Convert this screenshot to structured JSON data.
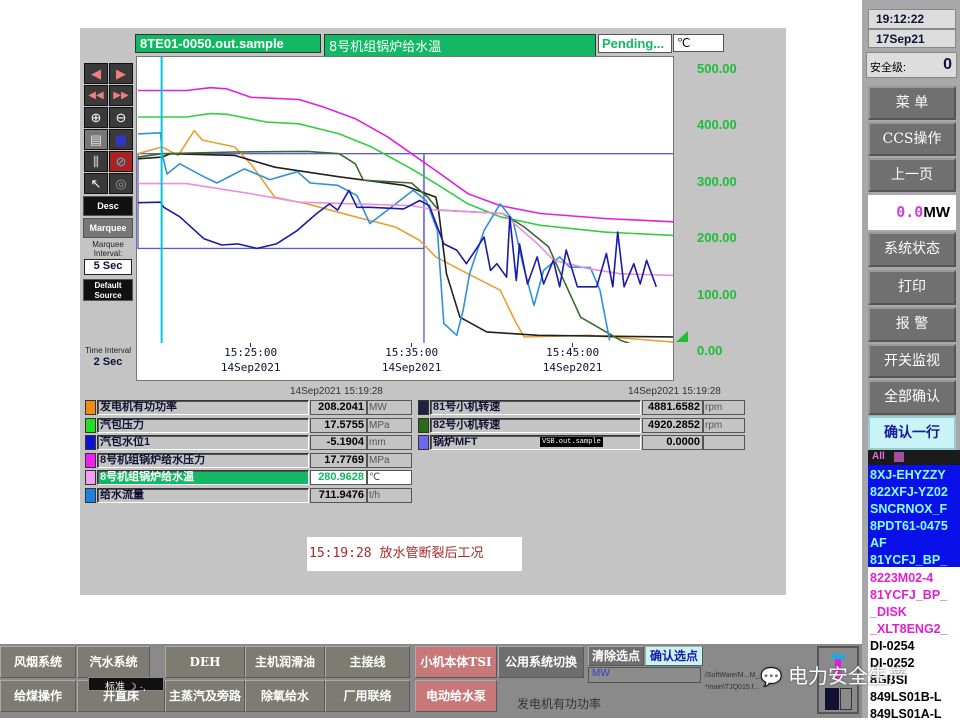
{
  "header": {
    "tag": "8TE01-0050.out.sample",
    "description": "8号机组锅炉给水温",
    "status": "Pending...",
    "unit": "℃"
  },
  "toolbar": {
    "icons": [
      "arrow-left-icon",
      "arrow-right-icon",
      "fast-rewind-icon",
      "fast-forward-icon",
      "zoom-in-icon",
      "zoom-out-icon",
      "window-icon",
      "table-icon",
      "trend-icon",
      "no-icon",
      "pointer-icon",
      "target-icon"
    ],
    "desc_label": "Desc",
    "marquee_label": "Marquee",
    "marquee_interval_label": "Marquee Interval:",
    "marquee_interval": "5 Sec",
    "default_source_label": "Default Source",
    "time_interval_label": "Time Interval :",
    "time_interval": "2 Sec"
  },
  "chart_data": {
    "type": "line",
    "ylim": [
      0,
      500
    ],
    "xlim": [
      "15:18:00",
      "15:51:18"
    ],
    "grid": false,
    "y_ticks": [
      "500.00",
      "400.00",
      "300.00",
      "200.00",
      "100.00",
      "0.00"
    ],
    "x_ticks": [
      {
        "time": "15:25:00",
        "date": "14Sep2021"
      },
      {
        "time": "15:35:00",
        "date": "14Sep2021"
      },
      {
        "time": "15:45:00",
        "date": "14Sep2021"
      }
    ],
    "cursor_time": "15:19:28",
    "cursor_color": "#00c8e0",
    "marquee": [
      {
        "from": "15:18:00",
        "to": "15:35:46",
        "low": 173,
        "high": 341
      },
      {
        "from": "15:35:46",
        "to": "15:51:18",
        "low": 0,
        "high": 341
      }
    ],
    "series": [
      {
        "name": "8号机组锅炉给水压力",
        "color": "#e020e0",
        "points": [
          [
            "15:18:00",
            453
          ],
          [
            "15:21:00",
            453
          ],
          [
            "15:22:30",
            458
          ],
          [
            "15:23:30",
            456
          ],
          [
            "15:25:00",
            441
          ],
          [
            "15:28:00",
            437
          ],
          [
            "15:29:30",
            424
          ],
          [
            "15:31:30",
            403
          ],
          [
            "15:33:30",
            371
          ],
          [
            "15:35:00",
            341
          ],
          [
            "15:36:30",
            311
          ],
          [
            "15:38:30",
            270
          ],
          [
            "15:40:30",
            249
          ],
          [
            "15:43:00",
            235
          ],
          [
            "15:47:00",
            226
          ],
          [
            "15:51:18",
            220
          ]
        ]
      },
      {
        "name": "汽包压力",
        "color": "#30d040",
        "points": [
          [
            "15:18:00",
            406
          ],
          [
            "15:21:00",
            406
          ],
          [
            "15:22:30",
            412
          ],
          [
            "15:23:30",
            411
          ],
          [
            "15:26:00",
            397
          ],
          [
            "15:28:00",
            394
          ],
          [
            "15:30:30",
            376
          ],
          [
            "15:32:30",
            353
          ],
          [
            "15:35:00",
            314
          ],
          [
            "15:36:30",
            288
          ],
          [
            "15:38:30",
            252
          ],
          [
            "15:40:30",
            229
          ],
          [
            "15:43:00",
            214
          ],
          [
            "15:47:00",
            202
          ],
          [
            "15:51:18",
            196
          ]
        ]
      },
      {
        "name": "发电机有功功率",
        "color": "#e8a030",
        "points": [
          [
            "15:18:00",
            341
          ],
          [
            "15:19:30",
            353
          ],
          [
            "15:20:30",
            338
          ],
          [
            "15:21:30",
            382
          ],
          [
            "15:22:00",
            365
          ],
          [
            "15:24:00",
            353
          ],
          [
            "15:25:00",
            323
          ],
          [
            "15:26:30",
            264
          ],
          [
            "15:28:30",
            252
          ],
          [
            "15:31:30",
            229
          ],
          [
            "15:34:00",
            211
          ],
          [
            "15:35:30",
            187
          ],
          [
            "15:36:30",
            158
          ],
          [
            "15:38:30",
            128
          ],
          [
            "15:40:30",
            99
          ],
          [
            "15:41:30",
            40
          ],
          [
            "15:42:00",
            16
          ],
          [
            "15:46:00",
            19
          ],
          [
            "15:51:18",
            7
          ]
        ]
      },
      {
        "name": "81号小机转速",
        "color": "#202020",
        "points": [
          [
            "15:18:00",
            332
          ],
          [
            "15:19:30",
            335
          ],
          [
            "15:20:00",
            341
          ],
          [
            "15:24:00",
            338
          ],
          [
            "15:26:30",
            317
          ],
          [
            "15:30:30",
            300
          ],
          [
            "15:34:30",
            285
          ],
          [
            "15:36:30",
            264
          ],
          [
            "15:36:40",
            241
          ],
          [
            "15:37:10",
            128
          ],
          [
            "15:38:00",
            51
          ],
          [
            "15:39:40",
            25
          ],
          [
            "15:42:50",
            19
          ],
          [
            "15:51:18",
            16
          ]
        ]
      },
      {
        "name": "82号小机转速",
        "color": "#3a6a2a",
        "points": [
          [
            "15:18:00",
            335
          ],
          [
            "15:19:30",
            341
          ],
          [
            "15:24:00",
            344
          ],
          [
            "15:28:30",
            345
          ],
          [
            "15:30:30",
            341
          ],
          [
            "15:31:30",
            323
          ],
          [
            "15:32:00",
            294
          ],
          [
            "15:35:00",
            289
          ],
          [
            "15:36:00",
            264
          ],
          [
            "15:36:40",
            241
          ],
          [
            "15:40:40",
            235
          ],
          [
            "15:42:00",
            211
          ],
          [
            "15:43:30",
            176
          ],
          [
            "15:44:10",
            134
          ],
          [
            "15:45:30",
            51
          ],
          [
            "15:48:00",
            10
          ],
          [
            "15:49:00",
            0
          ]
        ]
      },
      {
        "name": "给水流量",
        "color": "#3090d8",
        "points": [
          [
            "15:18:00",
            376
          ],
          [
            "15:19:24",
            378
          ],
          [
            "15:19:30",
            341
          ],
          [
            "15:19:48",
            305
          ],
          [
            "15:20:36",
            323
          ],
          [
            "15:22:06",
            300
          ],
          [
            "15:22:54",
            289
          ],
          [
            "15:24:36",
            314
          ],
          [
            "15:26:12",
            295
          ],
          [
            "15:27:54",
            309
          ],
          [
            "15:28:42",
            289
          ],
          [
            "15:30:24",
            285
          ],
          [
            "15:31:36",
            267
          ],
          [
            "15:32:24",
            217
          ],
          [
            "15:33:30",
            241
          ],
          [
            "15:35:06",
            276
          ],
          [
            "15:35:54",
            258
          ],
          [
            "15:36:36",
            205
          ],
          [
            "15:37:00",
            40
          ],
          [
            "15:37:48",
            19
          ],
          [
            "15:38:12",
            63
          ],
          [
            "15:38:36",
            128
          ],
          [
            "15:39:30",
            205
          ],
          [
            "15:40:30",
            252
          ],
          [
            "15:41:18",
            223
          ],
          [
            "15:41:54",
            146
          ],
          [
            "15:42:36",
            72
          ],
          [
            "15:43:12",
            134
          ],
          [
            "15:44:12",
            158
          ],
          [
            "15:44:48",
            140
          ],
          [
            "15:46:06",
            139
          ],
          [
            "15:46:42",
            99
          ],
          [
            "15:47:18",
            10
          ]
        ]
      },
      {
        "name": "8号机组锅炉给水温",
        "color": "#e890e0",
        "points": [
          [
            "15:18:00",
            288
          ],
          [
            "15:21:00",
            288
          ],
          [
            "15:25:00",
            270
          ],
          [
            "15:28:00",
            255
          ],
          [
            "15:35:00",
            249
          ],
          [
            "15:36:30",
            241
          ],
          [
            "15:40:40",
            235
          ],
          [
            "15:42:50",
            181
          ],
          [
            "15:43:50",
            152
          ],
          [
            "15:46:00",
            137
          ],
          [
            "15:48:00",
            128
          ],
          [
            "15:51:18",
            125
          ]
        ]
      },
      {
        "name": "汽包水位1",
        "color": "#1a1aa8",
        "points": [
          [
            "15:18:00",
            254
          ],
          [
            "15:19:24",
            255
          ],
          [
            "15:19:36",
            246
          ],
          [
            "15:20:36",
            229
          ],
          [
            "15:22:06",
            190
          ],
          [
            "15:23:12",
            179
          ],
          [
            "15:24:12",
            181
          ],
          [
            "15:25:24",
            173
          ],
          [
            "15:26:36",
            181
          ],
          [
            "15:27:54",
            205
          ],
          [
            "15:29:06",
            235
          ],
          [
            "15:29:54",
            252
          ],
          [
            "15:30:24",
            241
          ],
          [
            "15:31:06",
            276
          ],
          [
            "15:31:36",
            246
          ],
          [
            "15:32:24",
            246
          ],
          [
            "15:34:30",
            243
          ],
          [
            "15:35:30",
            258
          ],
          [
            "15:36:06",
            249
          ],
          [
            "15:37:00",
            181
          ],
          [
            "15:37:48",
            170
          ],
          [
            "15:38:24",
            146
          ],
          [
            "15:39:30",
            193
          ],
          [
            "15:39:54",
            134
          ],
          [
            "15:40:18",
            146
          ],
          [
            "15:40:54",
            122
          ],
          [
            "15:41:06",
            229
          ],
          [
            "15:41:30",
            116
          ],
          [
            "15:41:42",
            181
          ],
          [
            "15:42:12",
            110
          ],
          [
            "15:42:48",
            158
          ],
          [
            "15:43:12",
            110
          ],
          [
            "15:43:48",
            152
          ],
          [
            "15:44:12",
            105
          ],
          [
            "15:44:36",
            170
          ],
          [
            "15:45:18",
            105
          ],
          [
            "15:46:30",
            105
          ],
          [
            "15:47:06",
            164
          ],
          [
            "15:47:30",
            105
          ],
          [
            "15:47:48",
            202
          ],
          [
            "15:48:12",
            105
          ],
          [
            "15:48:48",
            146
          ],
          [
            "15:49:12",
            110
          ],
          [
            "15:49:36",
            152
          ],
          [
            "15:50:12",
            105
          ]
        ]
      }
    ]
  },
  "table": {
    "timestamp_left": "14Sep2021  15:19:28",
    "timestamp_right": "14Sep2021  15:19:28",
    "left_rows": [
      {
        "color": "#f08c14",
        "label": "发电机有功功率",
        "value": "208.2041",
        "unit": "MW"
      },
      {
        "color": "#20e020",
        "label": "汽包压力",
        "value": "17.5755",
        "unit": "MPa"
      },
      {
        "color": "#1010d0",
        "label": "汽包水位1",
        "value": "-5.1904",
        "unit": "mm"
      },
      {
        "color": "#f020f0",
        "label": "8号机组锅炉给水压力",
        "value": "17.7769",
        "unit": "MPa"
      },
      {
        "color": "#f0a0f0",
        "label": "8号机组锅炉给水温",
        "value": "280.9628",
        "unit": "℃",
        "selected": true
      },
      {
        "color": "#2080e0",
        "label": "给水流量",
        "value": "711.9476",
        "unit": "t/h"
      }
    ],
    "right_rows": [
      {
        "color": "#202040",
        "label": "81号小机转速",
        "value": "4881.6582",
        "unit": "rpm"
      },
      {
        "color": "#2a6a1a",
        "label": "82号小机转速",
        "value": "4920.2852",
        "unit": "rpm"
      },
      {
        "color": "#6a6af0",
        "label": "锅炉MFT",
        "tag": "VSB.out.sample",
        "value": "0.0000",
        "unit": ""
      }
    ]
  },
  "annotation": "15:19:28 放水管断裂后工况",
  "right_panel": {
    "time": "19:12:22",
    "date": "17Sep21",
    "security_label": "安全级:",
    "security_level": "0",
    "buttons": [
      "菜 单",
      "CCS操作",
      "上一页"
    ],
    "power_value": "0.0",
    "power_unit": "MW",
    "buttons2": [
      "系统状态",
      "打印",
      "报 警",
      "开关监视",
      "全部确认"
    ],
    "confirm_row": "确认一行",
    "alarm_filter": "All",
    "alarms_blue": [
      "8XJ-EHYZZY",
      "822XFJ-YZ02",
      "SNCRNOX_F",
      "8PDT61-0475",
      "AF",
      "81YCFJ_BP_"
    ],
    "alarms_pink": [
      "8223M02-4",
      "81YCFJ_BP_",
      "_DISK",
      "_XLT8ENG2_"
    ],
    "alarms_black": [
      "DI-0254",
      "DI-0252",
      "8GBSI",
      "849LS01B-L",
      "849LS01A-L"
    ]
  },
  "bottom": {
    "row1": [
      "风烟系统",
      "汽水系统",
      "DEH",
      "主机润滑油",
      "主接线",
      "小机本体TSI",
      "公用系统切换"
    ],
    "row2": [
      "给煤操作",
      "开直床",
      "主蒸汽及旁路",
      "除氧给水",
      "厂用联络",
      "电动给水泵"
    ],
    "clear_points": "清除选点",
    "confirm_points": "确认选点",
    "mw_field": "MW",
    "path1": "/SoftWare/M...M_",
    "path2": "*main\\TJQ015.f...",
    "status_text": "发电机有功功率",
    "ime_label": "标准"
  },
  "watermark": "电力安全生产"
}
